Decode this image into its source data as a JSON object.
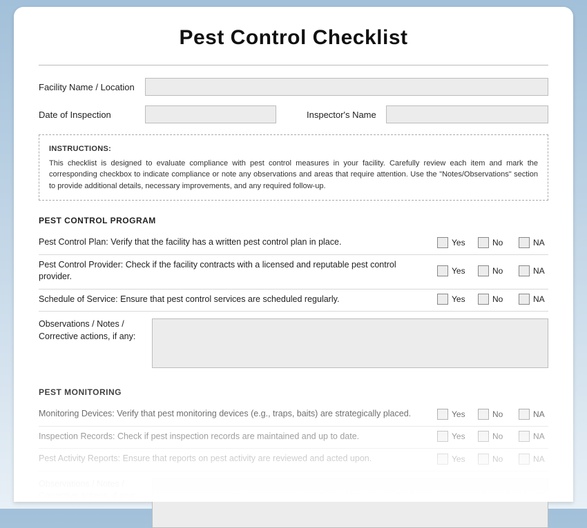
{
  "title": "Pest Control Checklist",
  "fields": {
    "facility_label": "Facility Name / Location",
    "date_label": "Date of Inspection",
    "inspector_label": "Inspector's Name"
  },
  "instructions": {
    "heading": "INSTRUCTIONS:",
    "body": "This checklist is designed to evaluate compliance with pest control measures in your facility. Carefully review each item and mark the corresponding checkbox to indicate compliance or note any observations and areas that require attention. Use the \"Notes/Observations\" section to provide additional details, necessary improvements, and any required follow-up."
  },
  "options": {
    "yes": "Yes",
    "no": "No",
    "na": "NA"
  },
  "notes_label": "Observations / Notes / Corrective actions, if any:",
  "sections": [
    {
      "title": "PEST CONTROL PROGRAM",
      "items": [
        "Pest Control Plan: Verify that the facility has a written pest control plan in place.",
        "Pest Control Provider: Check if the facility contracts with a licensed and reputable pest control provider.",
        "Schedule of Service: Ensure that pest control services are scheduled regularly."
      ]
    },
    {
      "title": "PEST MONITORING",
      "items": [
        "Monitoring Devices: Verify that pest monitoring devices (e.g., traps, baits) are strategically placed.",
        "Inspection Records: Check if pest inspection records are maintained and up to date.",
        "Pest Activity Reports: Ensure that reports on pest activity are reviewed and acted upon."
      ]
    }
  ]
}
